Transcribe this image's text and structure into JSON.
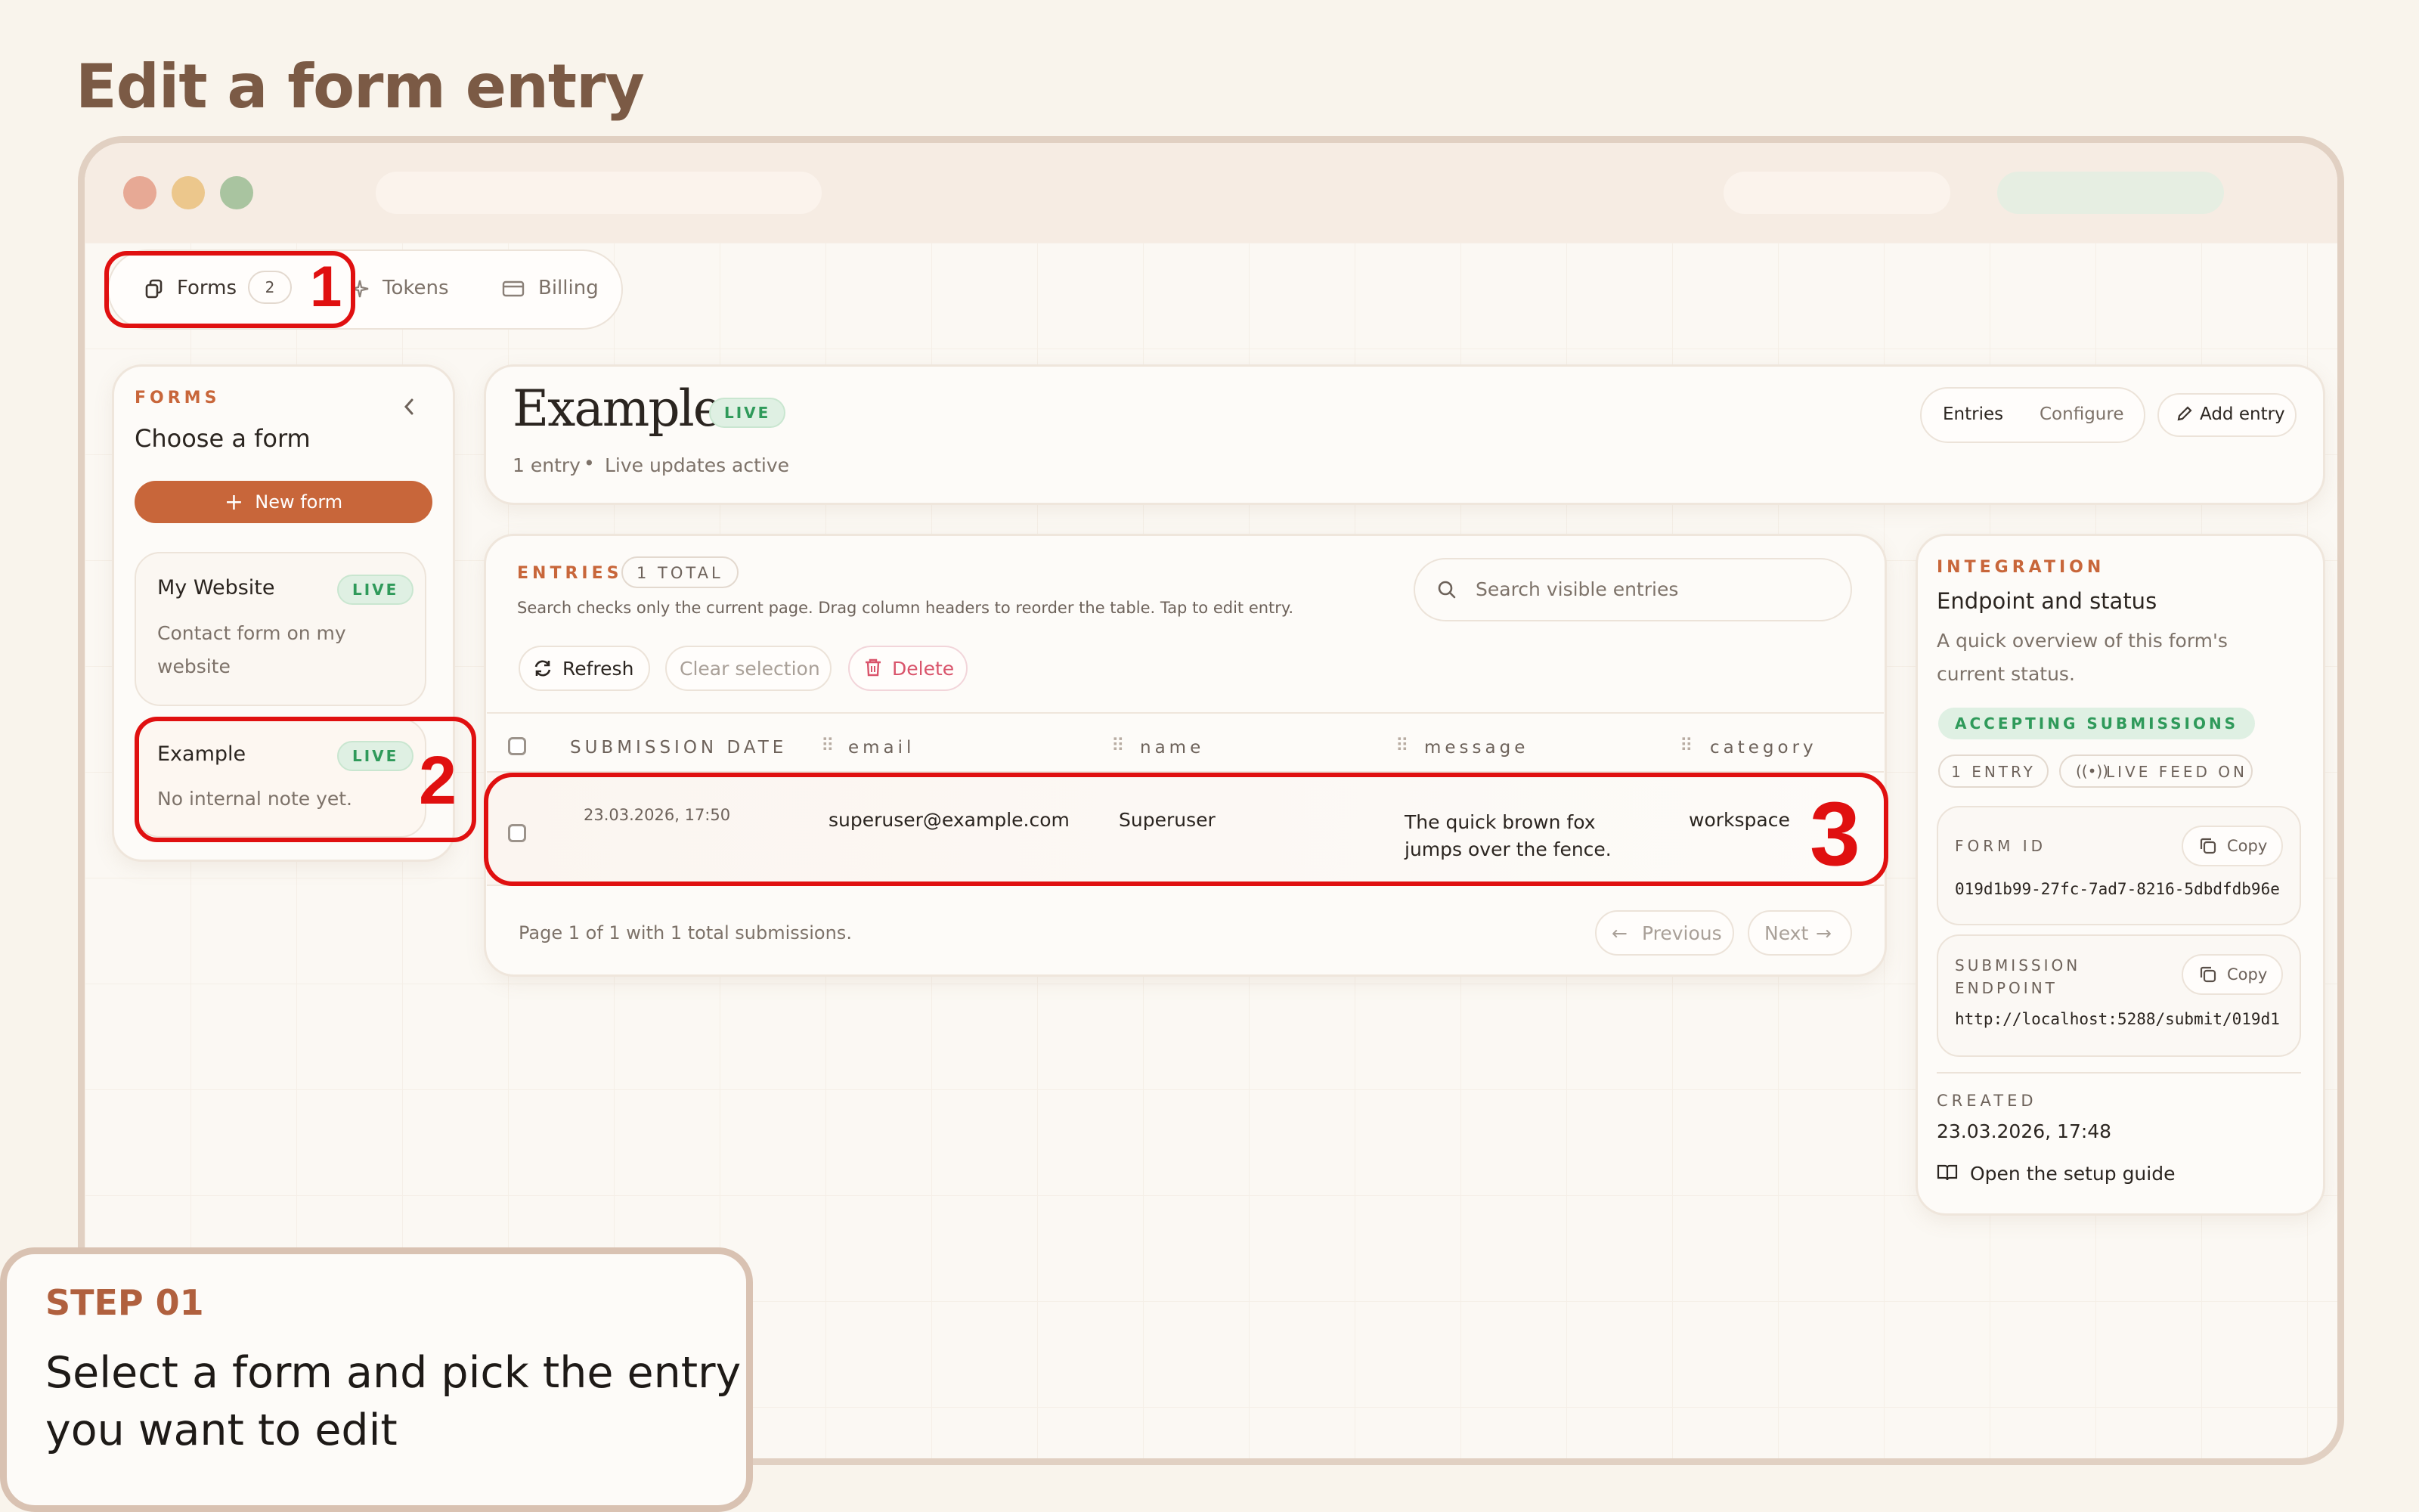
{
  "page_title": "Edit a form entry",
  "nav": {
    "forms_label": "Forms",
    "forms_count": "2",
    "tokens_label": "Tokens",
    "billing_label": "Billing"
  },
  "sidebar": {
    "section_label": "FORMS",
    "heading": "Choose a form",
    "new_form_label": "New form",
    "forms": [
      {
        "name": "My Website",
        "status": "LIVE",
        "note": "Contact form on my website"
      },
      {
        "name": "Example",
        "status": "LIVE",
        "note": "No internal note yet."
      }
    ]
  },
  "header": {
    "title": "Example",
    "status": "LIVE",
    "entry_count": "1 entry",
    "live_updates": "Live updates active",
    "tab_entries": "Entries",
    "tab_configure": "Configure",
    "add_entry": "Add entry"
  },
  "entries": {
    "section_label": "ENTRIES",
    "total_badge": "1 TOTAL",
    "help_text": "Search checks only the current page. Drag column headers to reorder the table. Tap to edit entry.",
    "search_placeholder": "Search visible entries",
    "refresh_label": "Refresh",
    "clear_label": "Clear selection",
    "delete_label": "Delete",
    "columns": [
      "SUBMISSION DATE",
      "email",
      "name",
      "message",
      "category"
    ],
    "rows": [
      {
        "date": "23.03.2026, 17:50",
        "email": "superuser@example.com",
        "name": "Superuser",
        "message_line1": "The quick brown fox",
        "message_line2": "jumps over the fence.",
        "category": "workspace"
      }
    ],
    "pagination_text": "Page 1 of 1 with 1 total submissions.",
    "previous_label": "Previous",
    "next_label": "Next"
  },
  "integration": {
    "section_label": "INTEGRATION",
    "heading": "Endpoint and status",
    "description": "A quick overview of this form's current status.",
    "accepting_badge": "ACCEPTING SUBMISSIONS",
    "entry_badge": "1 ENTRY",
    "feed_badge": "LIVE FEED ON",
    "form_id_label": "FORM ID",
    "form_id_value": "019d1b99-27fc-7ad7-8216-5dbdfdb96e",
    "copy_label": "Copy",
    "endpoint_label_1": "SUBMISSION",
    "endpoint_label_2": "ENDPOINT",
    "endpoint_value": "http://localhost:5288/submit/019d1",
    "created_label": "CREATED",
    "created_value": "23.03.2026, 17:48",
    "setup_guide": "Open the setup guide"
  },
  "annotations": {
    "one": "1",
    "two": "2",
    "three": "3"
  },
  "step": {
    "label": "STEP 01",
    "text_line1": "Select a form and pick the entry",
    "text_line2": "you want to edit"
  },
  "colors": {
    "accent": "#c8663a",
    "live_green": "#2f9a5a",
    "annotation_red": "#e01010",
    "delete_red": "#d9546b"
  }
}
